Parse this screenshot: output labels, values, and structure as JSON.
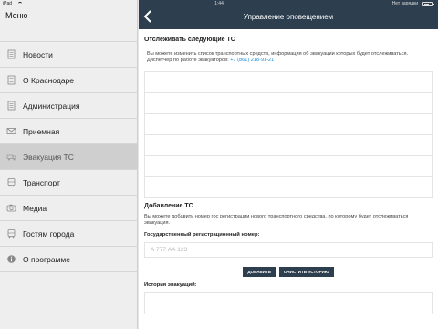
{
  "status_bar": {
    "carrier": "iPad",
    "time": "1:44",
    "right_text": "Нет зарядки"
  },
  "sidebar": {
    "title": "Меню",
    "items": [
      {
        "label": "Новости",
        "icon": "document-icon"
      },
      {
        "label": "О Краснодаре",
        "icon": "document-icon"
      },
      {
        "label": "Администрация",
        "icon": "document-icon"
      },
      {
        "label": "Приемная",
        "icon": "envelope-icon"
      },
      {
        "label": "Эвакуация ТС",
        "icon": "tow-truck-icon"
      },
      {
        "label": "Транспорт",
        "icon": "bus-icon"
      },
      {
        "label": "Медиа",
        "icon": "camera-icon"
      },
      {
        "label": "Гостям города",
        "icon": "bus-icon"
      },
      {
        "label": "О программе",
        "icon": "info-icon"
      }
    ],
    "active_index": 4
  },
  "header": {
    "title": "Управление оповещением",
    "back_icon": "chevron-left-icon"
  },
  "track_section": {
    "title": "Отслеживать следующие ТС",
    "description": "Вы можете изменить список транспортных средств, информация об эвакуации которых будет отслеживаться.",
    "dispatcher_label": "Диспетчер по работе эвакуаторов:",
    "dispatcher_phone": "+7 (861) 218-91-21",
    "rows_count": 6
  },
  "add_section": {
    "title": "Добавление ТС",
    "description": "Вы можете добавить номер гос регистрации нового транспортного средства, по которому будет отслеживаться эвакуация.",
    "field_label": "Государственный регистрационный номер:",
    "field_placeholder": "А 777 АА 123",
    "field_value": "",
    "add_button": "ДОБАВИТЬ",
    "clear_button": "ОЧИСТИТЬ ИСТОРИЮ"
  },
  "history": {
    "title": "История эвакуаций:"
  },
  "colors": {
    "navbar": "#2d3e4f",
    "link": "#1a8bd6",
    "sidebar_bg": "#eeeeee",
    "active_item": "#cfcfcf"
  }
}
